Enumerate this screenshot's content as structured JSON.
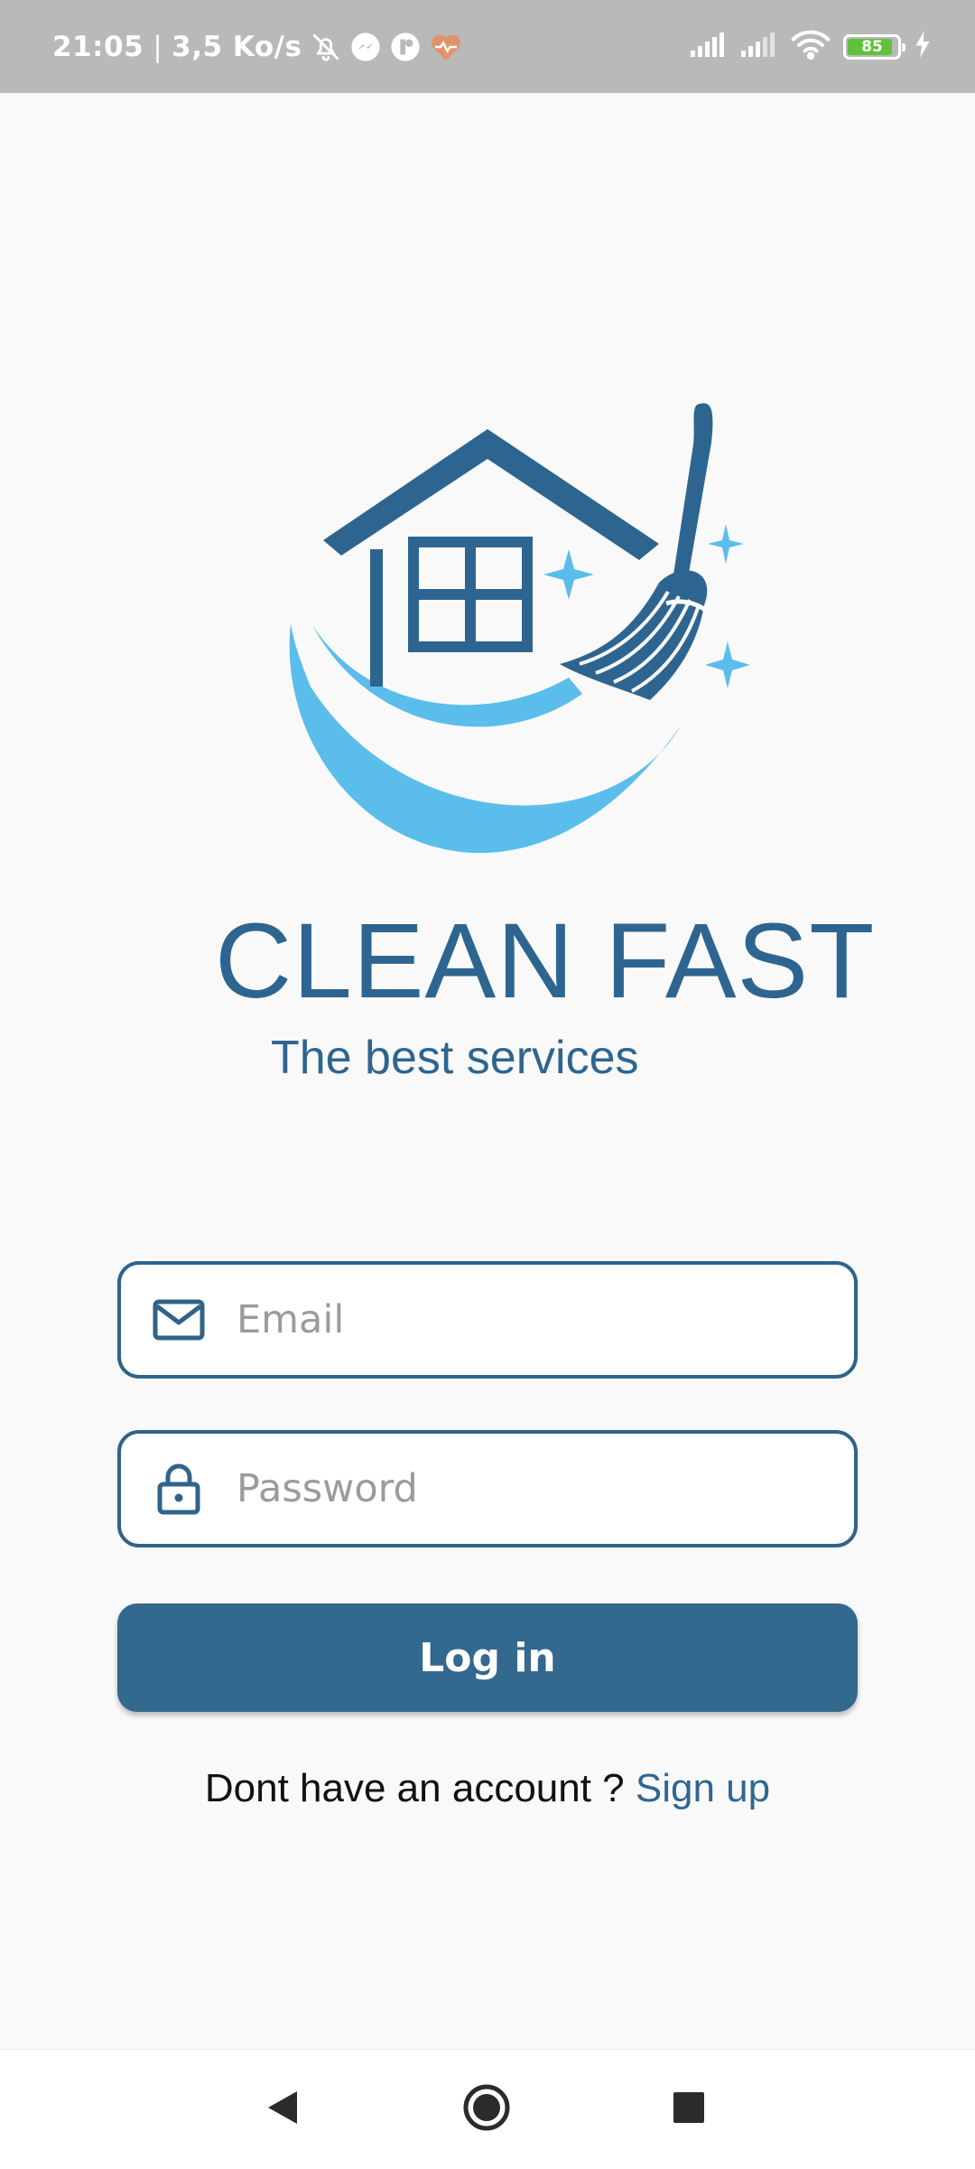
{
  "status_bar": {
    "time": "21:05",
    "separator": "|",
    "speed": "3,5 Ko/s",
    "battery_level": "85",
    "battery_color": "#5fc23a",
    "icons": [
      "bell-off-icon",
      "messenger-icon",
      "app-notification-icon",
      "heart-pulse-icon",
      "signal-icon",
      "signal-icon",
      "wifi-icon",
      "battery-icon",
      "charging-icon"
    ]
  },
  "brand": {
    "title": "CLEAN FAST",
    "subtitle": "The best services",
    "primary_color": "#2e6590",
    "accent_color": "#5bbdec"
  },
  "login_form": {
    "email_placeholder": "Email",
    "password_placeholder": "Password",
    "login_label": "Log in",
    "signup_prompt": "Dont have an account ? ",
    "signup_link": "Sign up"
  },
  "nav_bar": {
    "buttons": [
      "back-icon",
      "home-icon",
      "recents-icon"
    ]
  }
}
